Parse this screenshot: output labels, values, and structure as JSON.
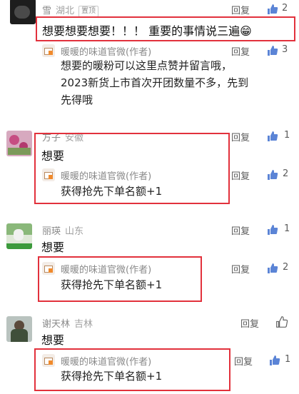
{
  "colors": {
    "highlight_border": "#e2313c",
    "like_blue": "#5b84d6",
    "author_accent": "#f08a2c"
  },
  "author_name": "暖暖的味道官微(作者)",
  "comments": [
    {
      "user": "雪",
      "region": "湖北",
      "badge": "置顶",
      "reply_label": "回复",
      "likes": "2",
      "text": "想要想要想要！！！ 重要的事情说三遍😁",
      "author_reply": {
        "reply_label": "回复",
        "likes": "3",
        "lines": [
          "想要的暖粉可以这里点赞并留言哦，",
          "2023新货上市首次开团数量不多，先到",
          "先得哦"
        ]
      }
    },
    {
      "user": "方子",
      "region": "安徽",
      "reply_label": "回复",
      "likes": "1",
      "text": "想要",
      "author_reply": {
        "reply_label": "回复",
        "likes": "2",
        "lines": [
          "获得抢先下单名额+1"
        ]
      }
    },
    {
      "user": "丽瑛",
      "region": "山东",
      "reply_label": "回复",
      "likes": "1",
      "text": "想要",
      "author_reply": {
        "reply_label": "回复",
        "likes": "2",
        "lines": [
          "获得抢先下单名额+1"
        ]
      }
    },
    {
      "user": "谢天林",
      "region": "吉林",
      "reply_label": "回复",
      "text": "想要",
      "author_reply": {
        "reply_label": "回复",
        "likes": "1",
        "lines": [
          "获得抢先下单名额+1"
        ]
      }
    }
  ]
}
